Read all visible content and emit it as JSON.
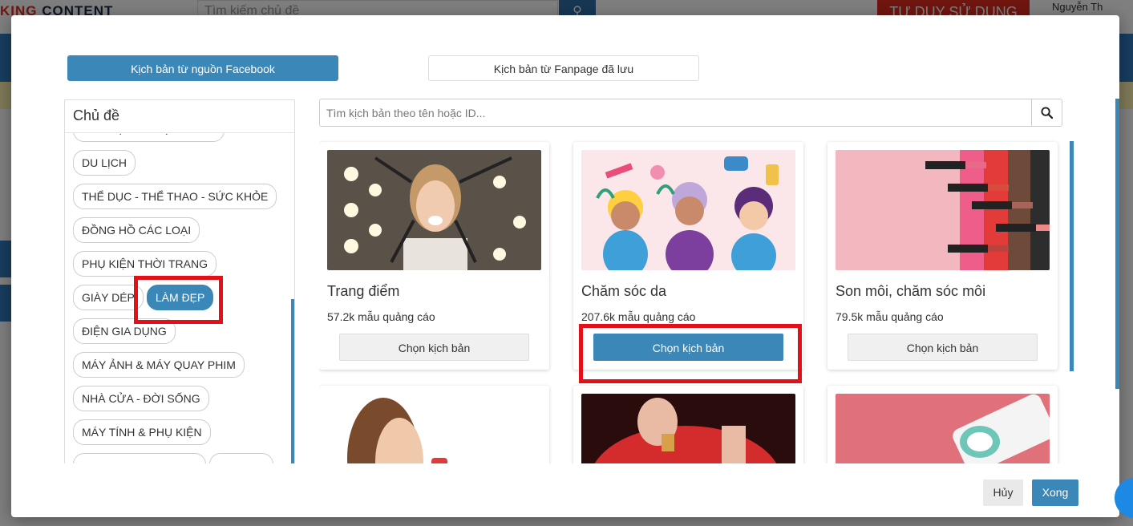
{
  "background": {
    "logo_prefix": "KING",
    "logo_suffix": " CONTENT",
    "search_placeholder": "Tìm kiếm chủ đề",
    "cta_label": "TƯ DUY SỬ DỤNG",
    "user_name": "Nguyễn Th"
  },
  "modal": {
    "tabs": {
      "facebook_label": "Kịch bản từ nguồn Facebook",
      "fanpage_label": "Kịch bản từ Fanpage đã lưu"
    },
    "topics": {
      "title": "Chủ đề",
      "items": [
        "ẨM THỰC & THỰC PHẨM",
        "DU LỊCH",
        "THỂ DỤC - THỂ THAO - SỨC KHỎE",
        "ĐỒNG HỒ CÁC LOẠI",
        "PHỤ KIỆN THỜI TRANG",
        "GIÀY DÉP",
        "LÀM ĐẸP",
        "ĐIỆN GIA DỤNG",
        "MÁY ẢNH & MÁY QUAY PHIM",
        "NHÀ CỬA - ĐỜI SỐNG",
        "MÁY TÍNH & PHỤ KIỆN"
      ],
      "active": "LÀM ĐẸP"
    },
    "search": {
      "placeholder": "Tìm kịch bản theo tên hoặc ID..."
    },
    "cards": [
      {
        "title": "Trang điểm",
        "count": "57.2k mẫu quảng cáo",
        "button": "Chọn kịch bản",
        "selected": false
      },
      {
        "title": "Chăm sóc da",
        "count": "207.6k mẫu quảng cáo",
        "button": "Chọn kịch bản",
        "selected": true
      },
      {
        "title": "Son môi, chăm sóc môi",
        "count": "79.5k mẫu quảng cáo",
        "button": "Chọn kịch bản",
        "selected": false
      }
    ],
    "footer": {
      "cancel_label": "Hủy",
      "done_label": "Xong"
    },
    "colors": {
      "primary": "#3a87b8",
      "highlight": "#e3101a"
    }
  }
}
